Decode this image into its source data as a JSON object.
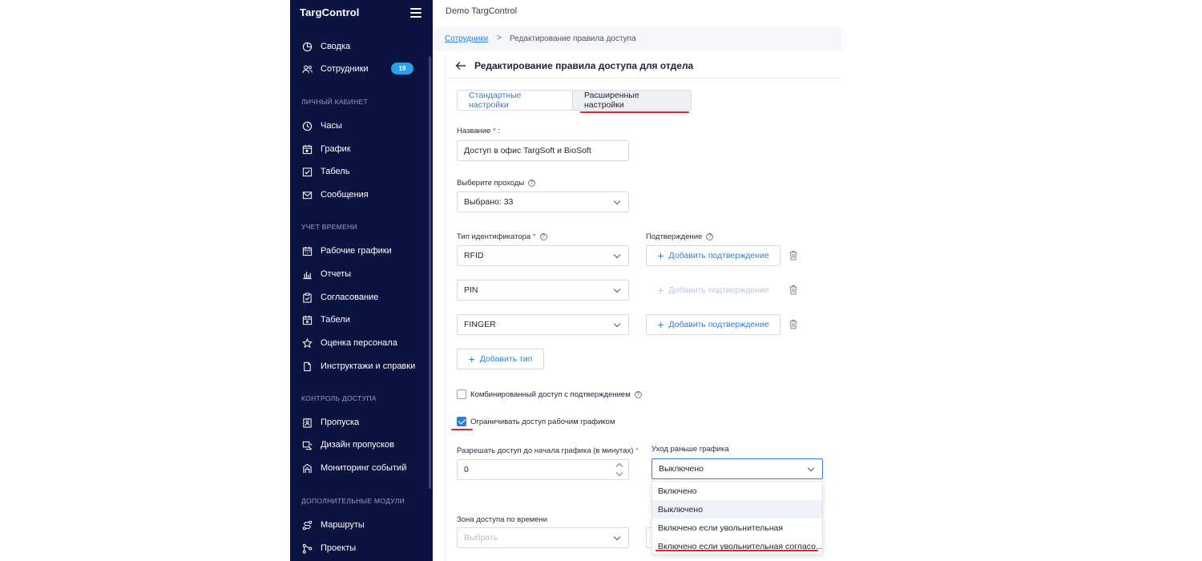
{
  "app": {
    "logo": "TargControl",
    "window_title": "Demo TargControl"
  },
  "sidebar": {
    "items_top": [
      {
        "label": "Сводка",
        "icon": "pie-chart-icon"
      },
      {
        "label": "Сотрудники",
        "icon": "users-icon",
        "badge": "19"
      }
    ],
    "sections": [
      {
        "title": "ЛИЧНЫЙ КАБИНЕТ",
        "items": [
          {
            "label": "Часы",
            "icon": "clock-icon"
          },
          {
            "label": "График",
            "icon": "calendar-icon"
          },
          {
            "label": "Табель",
            "icon": "checklist-icon"
          },
          {
            "label": "Сообщения",
            "icon": "mail-icon"
          }
        ]
      },
      {
        "title": "УЧЕТ ВРЕМЕНИ",
        "items": [
          {
            "label": "Рабочие графики",
            "icon": "calendar-grid-icon"
          },
          {
            "label": "Отчеты",
            "icon": "bar-chart-icon"
          },
          {
            "label": "Согласование",
            "icon": "clipboard-check-icon"
          },
          {
            "label": "Табели",
            "icon": "calendar-x-icon"
          },
          {
            "label": "Оценка персонала",
            "icon": "star-icon"
          },
          {
            "label": "Инструктажи и справки",
            "icon": "document-icon"
          }
        ]
      },
      {
        "title": "КОНТРОЛЬ ДОСТУПА",
        "items": [
          {
            "label": "Пропуска",
            "icon": "badge-icon"
          },
          {
            "label": "Дизайн пропусков",
            "icon": "design-icon"
          },
          {
            "label": "Мониторинг событий",
            "icon": "monitoring-icon"
          }
        ]
      },
      {
        "title": "ДОПОЛНИТЕЛЬНЫЕ МОДУЛИ",
        "items": [
          {
            "label": "Маршруты",
            "icon": "route-icon"
          },
          {
            "label": "Проекты",
            "icon": "projects-icon"
          }
        ]
      }
    ]
  },
  "breadcrumb": {
    "link": "Сотрудники",
    "separator": ">",
    "current": "Редактирование правила доступа"
  },
  "page": {
    "title": "Редактирование правила доступа для отдела",
    "tabs": [
      "Стандартные настройки",
      "Расширенные настройки"
    ],
    "name_label": "Название",
    "name_value": "Доступ в офис TargSoft и BioSoft",
    "passes_label": "Выберите проходы",
    "passes_value": "Выбрано: 33",
    "id_type_label": "Тип идентификатора",
    "confirm_label": "Подтверждение",
    "id_rows": [
      {
        "type": "RFID",
        "confirm": "Добавить подтверждение",
        "enabled": true
      },
      {
        "type": "PIN",
        "confirm": "Добавить подтверждение",
        "enabled": false
      },
      {
        "type": "FINGER",
        "confirm": "Добавить подтверждение",
        "enabled": true
      }
    ],
    "add_type": "Добавить тип",
    "combined_access": {
      "label": "Комбинированный доступ с подтверждением",
      "checked": false
    },
    "limit_schedule": {
      "label": "Ограничивать доступ рабочим графиком",
      "checked": true
    },
    "allow_before_label": "Разрешать доступ до начала графика (в минутах)",
    "allow_before_value": "0",
    "early_leave_label": "Уход раньше графика",
    "early_leave_value": "Выключено",
    "zone_label": "Зона доступа по времени",
    "zone_placeholder": "Выбрать",
    "dropdown_options": [
      "Включено",
      "Выключено",
      "Включено если увольнительная",
      "Включено если увольнительная согласо..."
    ]
  },
  "colors": {
    "sidebar_bg": "#0b1340",
    "accent": "#2f7fd6",
    "highlight_red": "#e0262b",
    "badge": "#2aa0e6"
  }
}
